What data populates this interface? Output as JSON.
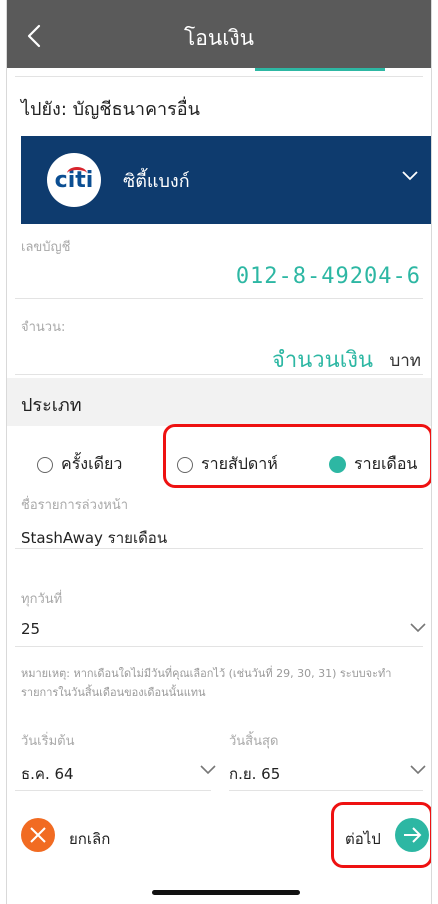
{
  "header": {
    "title": "โอนเงิน"
  },
  "destination": {
    "label": "ไปยัง: บัญชีธนาคารอื่น"
  },
  "bank": {
    "name": "ซิตี้แบงก์",
    "logo_text": "citi",
    "brand_color": "#0e3b6e"
  },
  "account": {
    "label": "เลขบัญชี",
    "number": "012-8-49204-6"
  },
  "amount": {
    "label": "จำนวน:",
    "placeholder": "จำนวนเงิน",
    "unit": "บาท"
  },
  "type_section": {
    "label": "ประเภท",
    "options": [
      {
        "label": "ครั้งเดียว",
        "selected": false
      },
      {
        "label": "รายสัปดาห์",
        "selected": false
      },
      {
        "label": "รายเดือน",
        "selected": true
      }
    ]
  },
  "schedule_name": {
    "label": "ชื่อรายการล่วงหน้า",
    "value": "StashAway รายเดือน"
  },
  "every_day": {
    "label": "ทุกวันที่",
    "value": "25"
  },
  "note": "หมายเหตุ: หากเดือนใดไม่มีวันที่คุณเลือกไว้ (เช่นวันที่ 29, 30, 31) ระบบจะทำรายการในวันสิ้นเดือนของเดือนนั้นแทน",
  "start_date": {
    "label": "วันเริ่มต้น",
    "value": "ธ.ค. 64"
  },
  "end_date": {
    "label": "วันสิ้นสุด",
    "value": "ก.ย. 65"
  },
  "actions": {
    "cancel_label": "ยกเลิก",
    "next_label": "ต่อไป"
  },
  "colors": {
    "accent": "#2db7a3",
    "header_bg": "#5a5a5a",
    "cancel": "#f16b22",
    "highlight": "#ee1111"
  }
}
